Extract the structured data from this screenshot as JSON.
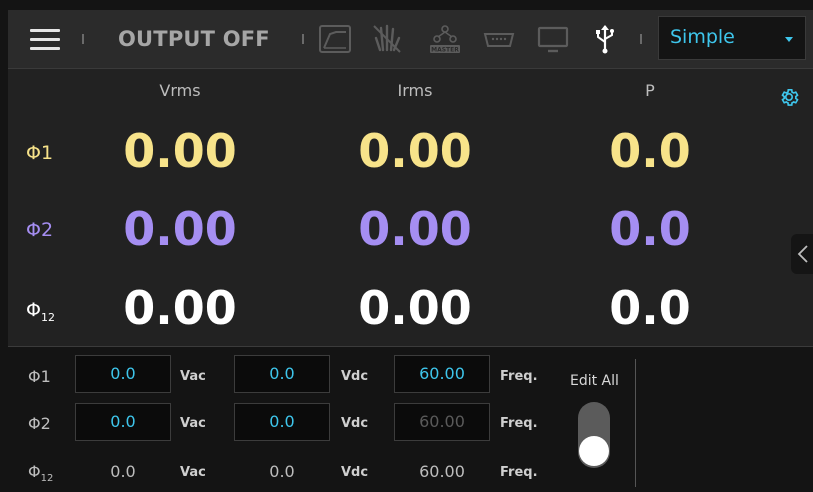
{
  "header": {
    "output_status": "OUTPUT OFF",
    "mode": {
      "selected": "Simple"
    },
    "icons": [
      "menu-icon",
      "waveform-icon",
      "gesture-lock-icon",
      "master-icon",
      "serial-port-icon",
      "monitor-icon",
      "usb-icon"
    ],
    "master_icon_text": "MASTER"
  },
  "measurements": {
    "columns": [
      "Vrms",
      "Irms",
      "P"
    ],
    "rows": [
      {
        "phase": "Φ1",
        "values": [
          "0.00",
          "0.00",
          "0.0"
        ],
        "color": "#f7e38a"
      },
      {
        "phase": "Φ2",
        "values": [
          "0.00",
          "0.00",
          "0.0"
        ],
        "color": "#a58ef2"
      },
      {
        "phase": "Φ",
        "phase_sub": "12",
        "values": [
          "0.00",
          "0.00",
          "0.0"
        ],
        "color": "#ffffff"
      }
    ]
  },
  "settings": {
    "rows": [
      {
        "phase": "Φ1",
        "vac": "0.0",
        "vdc": "0.0",
        "freq": "60.00"
      },
      {
        "phase": "Φ2",
        "vac": "0.0",
        "vdc": "0.0",
        "freq": "60.00"
      },
      {
        "phase": "Φ",
        "phase_sub": "12",
        "vac": "0.0",
        "vdc": "0.0",
        "freq": "60.00"
      }
    ],
    "units": {
      "vac": "Vac",
      "vdc": "Vdc",
      "freq": "Freq."
    },
    "edit_all_label": "Edit All",
    "edit_all_on": true
  },
  "colors": {
    "accent": "#3ec6ec",
    "phase1": "#f7e38a",
    "phase2": "#a58ef2",
    "phase12": "#ffffff"
  }
}
